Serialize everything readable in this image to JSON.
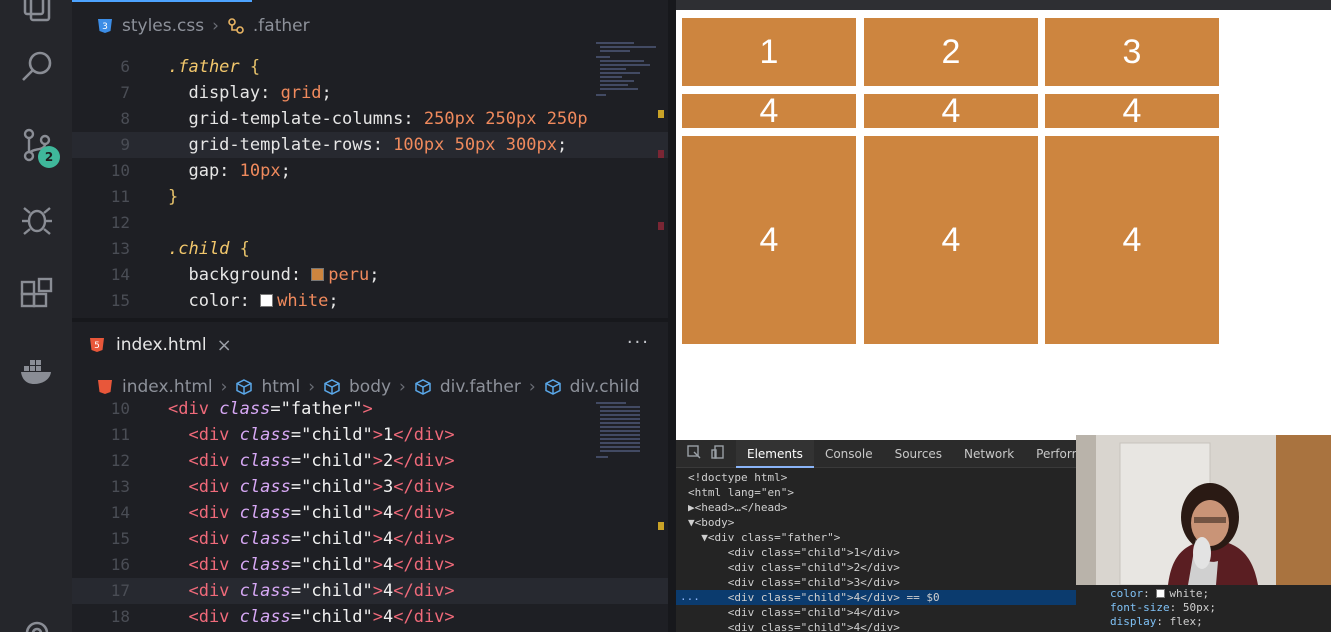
{
  "activity_bar": {
    "icons": [
      "explorer-icon",
      "search-icon",
      "source-control-icon",
      "debug-icon",
      "extensions-icon",
      "docker-icon",
      "settings-icon"
    ],
    "source_control_badge": "2"
  },
  "css_editor": {
    "breadcrumb": {
      "file": "styles.css",
      "symbol": ".father"
    },
    "lines": [
      {
        "n": "6",
        "parts": [
          {
            "c": "tk-sel",
            "t": ".father"
          },
          {
            "c": "tk-brace",
            "t": " {"
          }
        ]
      },
      {
        "n": "7",
        "parts": [
          {
            "c": "tk-prop",
            "t": "  display: "
          },
          {
            "c": "tk-val",
            "t": "grid"
          },
          {
            "c": "tk-prop",
            "t": ";"
          }
        ]
      },
      {
        "n": "8",
        "parts": [
          {
            "c": "tk-prop",
            "t": "  grid-template-columns: "
          },
          {
            "c": "tk-val",
            "t": "250px 250px 250p"
          }
        ]
      },
      {
        "n": "9",
        "parts": [
          {
            "c": "tk-prop",
            "t": "  grid-template-rows: "
          },
          {
            "c": "tk-val",
            "t": "100px 50px 300px"
          },
          {
            "c": "tk-prop",
            "t": ";"
          }
        ]
      },
      {
        "n": "10",
        "parts": [
          {
            "c": "tk-prop",
            "t": "  gap: "
          },
          {
            "c": "tk-val",
            "t": "10px"
          },
          {
            "c": "tk-prop",
            "t": ";"
          }
        ]
      },
      {
        "n": "11",
        "parts": [
          {
            "c": "tk-brace",
            "t": "}"
          }
        ]
      },
      {
        "n": "12",
        "parts": []
      },
      {
        "n": "13",
        "parts": [
          {
            "c": "tk-sel",
            "t": ".child"
          },
          {
            "c": "tk-brace",
            "t": " {"
          }
        ]
      },
      {
        "n": "14",
        "parts": [
          {
            "c": "tk-prop",
            "t": "  background: "
          },
          {
            "c": "swatch",
            "t": "#cd853f"
          },
          {
            "c": "tk-val",
            "t": "peru"
          },
          {
            "c": "tk-prop",
            "t": ";"
          }
        ]
      },
      {
        "n": "15",
        "parts": [
          {
            "c": "tk-prop",
            "t": "  color: "
          },
          {
            "c": "swatch",
            "t": "#ffffff"
          },
          {
            "c": "tk-val",
            "t": "white"
          },
          {
            "c": "tk-prop",
            "t": ";"
          }
        ]
      }
    ]
  },
  "html_editor": {
    "tab_label": "index.html",
    "more_label": "···",
    "breadcrumb": [
      "index.html",
      "html",
      "body",
      "div.father",
      "div.child"
    ],
    "lines": [
      {
        "n": "10",
        "parts": [
          {
            "c": "tk-tag",
            "t": "<div "
          },
          {
            "c": "tk-attr",
            "t": "class"
          },
          {
            "c": "tk-str",
            "t": "=\"father\""
          },
          {
            "c": "tk-tag",
            "t": ">"
          }
        ]
      },
      {
        "n": "11",
        "parts": [
          {
            "c": "tk-tag",
            "t": "  <div "
          },
          {
            "c": "tk-attr",
            "t": "class"
          },
          {
            "c": "tk-str",
            "t": "=\"child\""
          },
          {
            "c": "tk-tag",
            "t": ">"
          },
          {
            "c": "tk-txt",
            "t": "1"
          },
          {
            "c": "tk-tag",
            "t": "</div>"
          }
        ]
      },
      {
        "n": "12",
        "parts": [
          {
            "c": "tk-tag",
            "t": "  <div "
          },
          {
            "c": "tk-attr",
            "t": "class"
          },
          {
            "c": "tk-str",
            "t": "=\"child\""
          },
          {
            "c": "tk-tag",
            "t": ">"
          },
          {
            "c": "tk-txt",
            "t": "2"
          },
          {
            "c": "tk-tag",
            "t": "</div>"
          }
        ]
      },
      {
        "n": "13",
        "parts": [
          {
            "c": "tk-tag",
            "t": "  <div "
          },
          {
            "c": "tk-attr",
            "t": "class"
          },
          {
            "c": "tk-str",
            "t": "=\"child\""
          },
          {
            "c": "tk-tag",
            "t": ">"
          },
          {
            "c": "tk-txt",
            "t": "3"
          },
          {
            "c": "tk-tag",
            "t": "</div>"
          }
        ]
      },
      {
        "n": "14",
        "parts": [
          {
            "c": "tk-tag",
            "t": "  <div "
          },
          {
            "c": "tk-attr",
            "t": "class"
          },
          {
            "c": "tk-str",
            "t": "=\"child\""
          },
          {
            "c": "tk-tag",
            "t": ">"
          },
          {
            "c": "tk-txt",
            "t": "4"
          },
          {
            "c": "tk-tag",
            "t": "</div>"
          }
        ]
      },
      {
        "n": "15",
        "parts": [
          {
            "c": "tk-tag",
            "t": "  <div "
          },
          {
            "c": "tk-attr",
            "t": "class"
          },
          {
            "c": "tk-str",
            "t": "=\"child\""
          },
          {
            "c": "tk-tag",
            "t": ">"
          },
          {
            "c": "tk-txt",
            "t": "4"
          },
          {
            "c": "tk-tag",
            "t": "</div>"
          }
        ]
      },
      {
        "n": "16",
        "parts": [
          {
            "c": "tk-tag",
            "t": "  <div "
          },
          {
            "c": "tk-attr",
            "t": "class"
          },
          {
            "c": "tk-str",
            "t": "=\"child\""
          },
          {
            "c": "tk-tag",
            "t": ">"
          },
          {
            "c": "tk-txt",
            "t": "4"
          },
          {
            "c": "tk-tag",
            "t": "</div>"
          }
        ]
      },
      {
        "n": "17",
        "parts": [
          {
            "c": "tk-tag",
            "t": "  <div "
          },
          {
            "c": "tk-attr",
            "t": "class"
          },
          {
            "c": "tk-str",
            "t": "=\"child\""
          },
          {
            "c": "tk-tag",
            "t": ">"
          },
          {
            "c": "tk-txt",
            "t": "4"
          },
          {
            "c": "tk-tag",
            "t": "</div>"
          }
        ]
      },
      {
        "n": "18",
        "parts": [
          {
            "c": "tk-tag",
            "t": "  <div "
          },
          {
            "c": "tk-attr",
            "t": "class"
          },
          {
            "c": "tk-str",
            "t": "=\"child\""
          },
          {
            "c": "tk-tag",
            "t": ">"
          },
          {
            "c": "tk-txt",
            "t": "4"
          },
          {
            "c": "tk-tag",
            "t": "</div>"
          }
        ]
      }
    ]
  },
  "preview": {
    "cells": [
      "1",
      "2",
      "3",
      "4",
      "4",
      "4",
      "4",
      "4",
      "4"
    ],
    "cell_background": "#cd853f",
    "cell_color": "#ffffff"
  },
  "devtools": {
    "tabs": [
      "Elements",
      "Console",
      "Sources",
      "Network",
      "Performa"
    ],
    "active_tab": "Elements",
    "dom_lines": [
      {
        "text": "<!doctype html>"
      },
      {
        "text": "<html lang=\"en\">"
      },
      {
        "text": "▶<head>…</head>"
      },
      {
        "text": "▼<body>"
      },
      {
        "text": "  ▼<div class=\"father\">"
      },
      {
        "text": "      <div class=\"child\">1</div>"
      },
      {
        "text": "      <div class=\"child\">2</div>"
      },
      {
        "text": "      <div class=\"child\">3</div>"
      },
      {
        "text": "      <div class=\"child\">4</div> == $0",
        "selected": true
      },
      {
        "text": "      <div class=\"child\">4</div>"
      },
      {
        "text": "      <div class=\"child\">4</div>"
      }
    ],
    "ellipsis": "...",
    "styles": [
      {
        "prop": "color",
        "value": "white;",
        "swatch": "#ffffff"
      },
      {
        "prop": "font-size",
        "value": "50px;"
      },
      {
        "prop": "display",
        "value": "flex;"
      }
    ]
  }
}
